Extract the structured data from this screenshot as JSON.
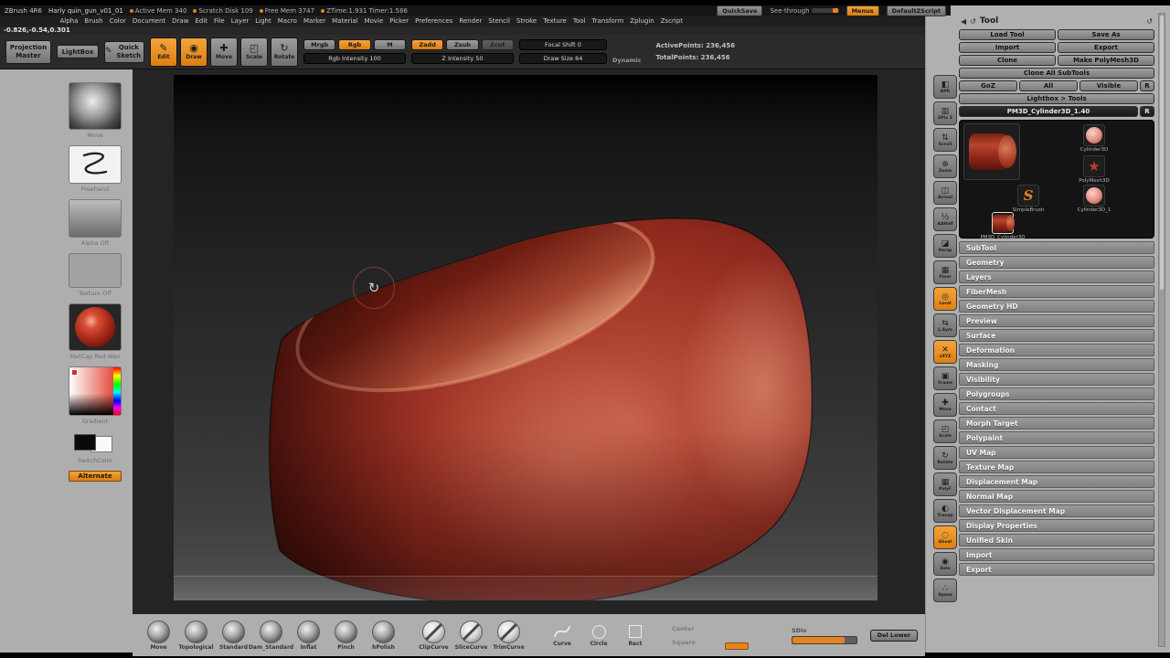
{
  "titlebar": {
    "app_name": "ZBrush 4R6",
    "doc_name": "Harly quin_gun_v01_01",
    "stats": [
      "Active Mem 340",
      "Scratch Disk 109",
      "Free Mem 3747",
      "ZTime:1.931  Timer:1.586"
    ],
    "quicksave": "QuickSave",
    "see_through": "See-through",
    "menus": "Menus",
    "zscript": "DefaultZScript"
  },
  "menubar": {
    "items": [
      "Alpha",
      "Brush",
      "Color",
      "Document",
      "Draw",
      "Edit",
      "File",
      "Layer",
      "Light",
      "Macro",
      "Marker",
      "Material",
      "Movie",
      "Picker",
      "Preferences",
      "Render",
      "Stencil",
      "Stroke",
      "Texture",
      "Tool",
      "Transform",
      "Zplugin",
      "Zscript"
    ]
  },
  "coords": "-0.826,-0.54,0.301",
  "toolbar": {
    "projection_master": "Projection Master",
    "lightbox": "LightBox",
    "quick_sketch": "Quick Sketch",
    "quick_sketch_glyph": "✎",
    "modes": [
      {
        "label": "Edit",
        "glyph": "✎",
        "active": true
      },
      {
        "label": "Draw",
        "glyph": "◉",
        "active": true
      },
      {
        "label": "Move",
        "glyph": "✚"
      },
      {
        "label": "Scale",
        "glyph": "◰"
      },
      {
        "label": "Rotate",
        "glyph": "↻"
      }
    ],
    "paint_modes": [
      {
        "label": "Mrgb"
      },
      {
        "label": "Rgb",
        "active": true
      },
      {
        "label": "M"
      }
    ],
    "rgb_intensity": "Rgb Intensity 100",
    "sculpt_modes": [
      {
        "label": "Zadd",
        "active": true
      },
      {
        "label": "Zsub"
      },
      {
        "label": "Zcut",
        "dim": true
      }
    ],
    "z_intensity": "Z Intensity 50",
    "focal_shift": "Focal Shift 0",
    "draw_size": "Draw Size 64",
    "dynamic": "Dynamic",
    "active_points": "ActivePoints: 236,456",
    "total_points": "TotalPoints: 236,456"
  },
  "tray": {
    "brush_label": "Move",
    "stroke_label": "Freehand",
    "alpha_label": "Alpha Off",
    "texture_label": "Texture Off",
    "material_label": "MatCap Red Wax",
    "gradient_label": "Gradient",
    "switch_label": "SwitchColor",
    "alternate": "Alternate"
  },
  "canvas": {
    "rotate_glyph": "↻"
  },
  "shelf": {
    "items": [
      {
        "label": "BPR",
        "glyph": "◧"
      },
      {
        "label": "SPix 3",
        "glyph": "▥"
      },
      {
        "label": "Scroll",
        "glyph": "⇅"
      },
      {
        "label": "Zoom",
        "glyph": "⊕"
      },
      {
        "label": "Actual",
        "glyph": "◫"
      },
      {
        "label": "AAHalf",
        "glyph": "½"
      },
      {
        "label": "Persp",
        "glyph": "◪"
      },
      {
        "label": "Floor",
        "glyph": "▦"
      },
      {
        "label": "Local",
        "glyph": "◎",
        "active": true
      },
      {
        "label": "L.Sym",
        "glyph": "⇆"
      },
      {
        "label": "xXYZ",
        "glyph": "✕",
        "active": true
      },
      {
        "label": "Frame",
        "glyph": "▣"
      },
      {
        "label": "Move",
        "glyph": "✚"
      },
      {
        "label": "Scale",
        "glyph": "◰"
      },
      {
        "label": "Rotate",
        "glyph": "↻"
      },
      {
        "label": "PolyF",
        "glyph": "▦"
      },
      {
        "label": "Transp",
        "glyph": "◐"
      },
      {
        "label": "Ghost",
        "glyph": "◌",
        "active": true
      },
      {
        "label": "Solo",
        "glyph": "◉"
      },
      {
        "label": "Xpose",
        "glyph": "∴"
      }
    ]
  },
  "tool": {
    "title": "Tool",
    "collapse_glyph": "◀",
    "history_glyph": "↺",
    "buttons": {
      "load_tool": "Load Tool",
      "save_as": "Save As",
      "import": "Import",
      "export": "Export",
      "clone": "Clone",
      "make_polymesh": "Make PolyMesh3D",
      "clone_all": "Clone All SubTools",
      "goz": "GoZ",
      "all": "All",
      "visible": "Visible",
      "r": "R",
      "lightbox_tools": "Lightbox > Tools",
      "current_tool": "PM3D_Cylinder3D_1.40",
      "r2": "R"
    },
    "thumbs": {
      "t1": "Cylinder3D",
      "t2": "PolyMesh3D",
      "t3": "SimpleBrush",
      "t4": "Cylinder3D_1",
      "t5": "PM3D_Cylinder3D",
      "star_glyph": "★",
      "s_glyph": "S"
    },
    "sections": [
      "SubTool",
      "Geometry",
      "Layers",
      "FiberMesh",
      "Geometry HD",
      "Preview",
      "Surface",
      "Deformation",
      "Masking",
      "Visibility",
      "Polygroups",
      "Contact",
      "Morph Target",
      "Polypaint",
      "UV Map",
      "Texture Map",
      "Displacement Map",
      "Normal Map",
      "Vector Displacement Map",
      "Display Properties",
      "Unified Skin",
      "Import",
      "Export"
    ]
  },
  "bottom": {
    "brushes": [
      {
        "label": "Move"
      },
      {
        "label": "Topological"
      },
      {
        "label": "Standard"
      },
      {
        "label": "Dam_Standard"
      },
      {
        "label": "Inflat"
      },
      {
        "label": "Pinch"
      },
      {
        "label": "hPolish"
      }
    ],
    "clip_brushes": [
      {
        "label": "ClipCurve"
      },
      {
        "label": "SliceCurve"
      },
      {
        "label": "TrimCurve"
      }
    ],
    "strokes": {
      "curve": "Curve",
      "circle": "Circle",
      "rect": "Rect"
    },
    "center": "Center",
    "square": "Square",
    "sdiv": "SDiv",
    "del_lower": "Del Lower"
  }
}
